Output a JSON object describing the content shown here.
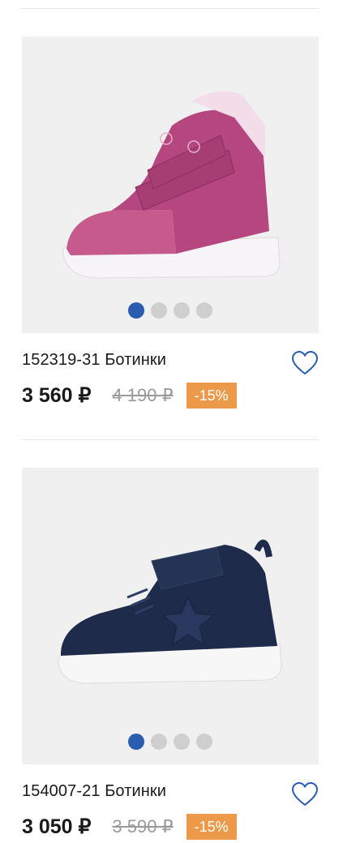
{
  "products": [
    {
      "image_alt": "",
      "title": "152319-31 Ботинки",
      "price": "3 560 ₽",
      "old_price": "4 190 ₽",
      "discount": "-15%",
      "shoe_color": "#b5467f",
      "slides": 4,
      "active_slide": 1
    },
    {
      "image_alt": "",
      "title": "154007-21 Ботинки",
      "price": "3 050 ₽",
      "old_price": "3 590 ₽",
      "discount": "-15%",
      "shoe_color": "#1f2b4a",
      "slides": 4,
      "active_slide": 1
    }
  ],
  "icons": {
    "favorite": "heart-outline-icon"
  },
  "colors": {
    "accent": "#2a5db0",
    "discount_badge": "#ec9a4a",
    "heart": "#2a5db0"
  }
}
